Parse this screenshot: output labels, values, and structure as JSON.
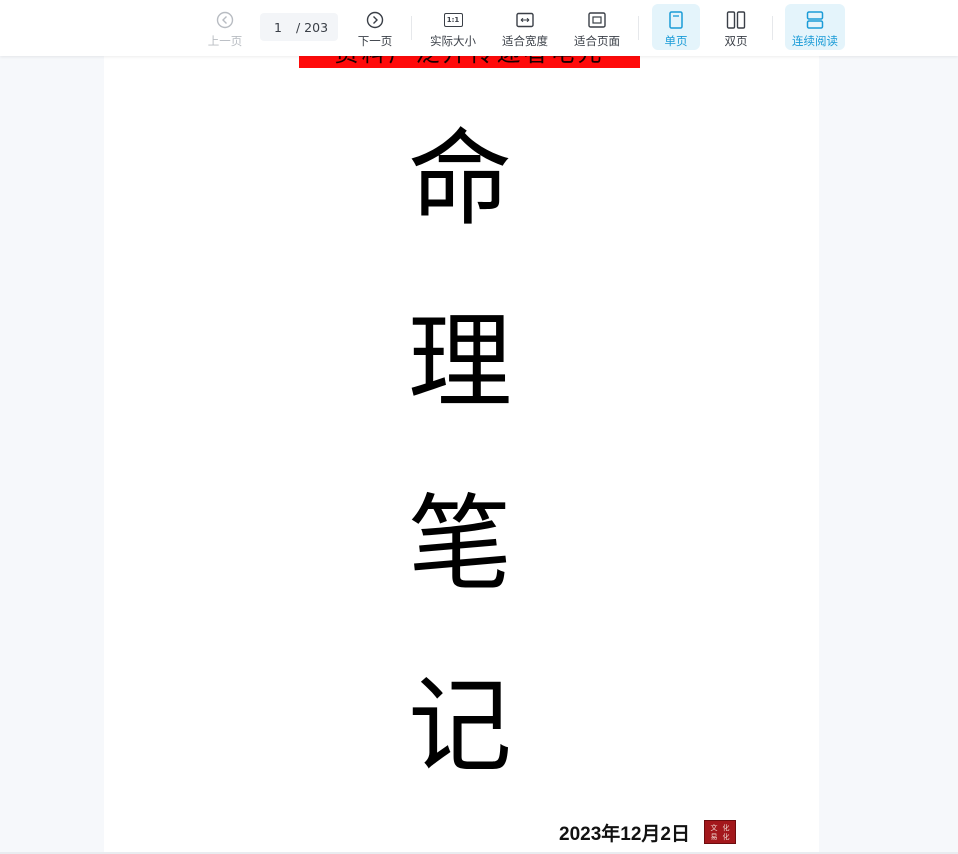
{
  "toolbar": {
    "prev_label": "上一页",
    "current_page": "1",
    "total_pages": "/ 203",
    "next_label": "下一页",
    "actual_size_label": "实际大小",
    "actual_size_icon_text": "1:1",
    "fit_width_label": "适合宽度",
    "fit_page_label": "适合页面",
    "single_page_label": "单页",
    "double_page_label": "双页",
    "continuous_label": "连续阅读",
    "active_color": "#1a9bd7",
    "disabled_color": "#b8bcc2"
  },
  "document": {
    "banner_text": "资料广泛开传递者电元",
    "title_chars": [
      "命",
      "理",
      "笔",
      "记"
    ],
    "date": "2023年12月2日",
    "seal_chars": [
      "文",
      "化",
      "易",
      "化"
    ],
    "banner_color": "#ff0a0a",
    "seal_color": "#a3181c"
  }
}
